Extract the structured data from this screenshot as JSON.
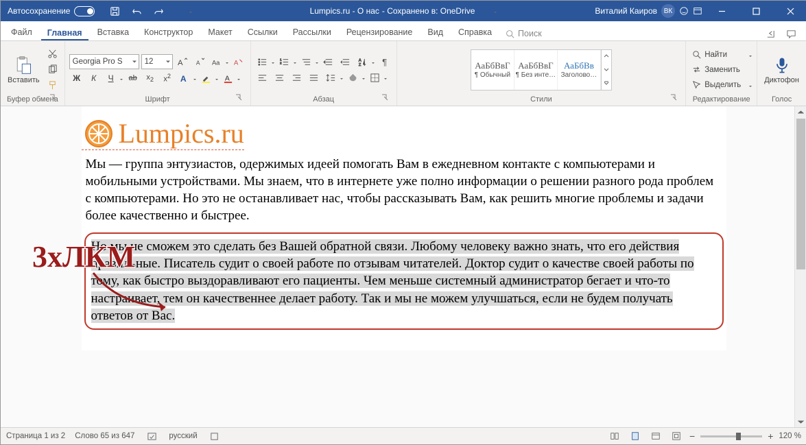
{
  "titlebar": {
    "autosave": "Автосохранение",
    "doc_title": "Lumpics.ru - О нас",
    "saved": "- Сохранено в: OneDrive",
    "user": "Виталий Каиров",
    "user_initials": "ВК"
  },
  "tabs": {
    "file": "Файл",
    "home": "Главная",
    "insert": "Вставка",
    "design": "Конструктор",
    "layout": "Макет",
    "references": "Ссылки",
    "mailings": "Рассылки",
    "review": "Рецензирование",
    "view": "Вид",
    "help": "Справка",
    "search": "Поиск"
  },
  "ribbon": {
    "paste": "Вставить",
    "clipboard": "Буфер обмена",
    "font_name": "Georgia Pro S",
    "font_size": "12",
    "font": "Шрифт",
    "paragraph": "Абзац",
    "style1": "¶ Обычный",
    "style2": "¶ Без инте…",
    "style3": "Заголово…",
    "style_preview": "АаБбВвГ",
    "style_preview3": "АаБбВв",
    "styles": "Стили",
    "find": "Найти",
    "replace": "Заменить",
    "select": "Выделить",
    "editing": "Редактирование",
    "dictate": "Диктофон",
    "voice": "Голос"
  },
  "document": {
    "logo": "Lumpics.ru",
    "p1": "Мы — группа энтузиастов, одержимых идеей помогать Вам в ежедневном контакте с компьютерами и мобильными устройствами. Мы знаем, что в интернете уже полно информации о решении разного рода проблем с компьютерами. Но это не останавливает нас, чтобы рассказывать Вам, как решить многие проблемы и задачи более качественно и быстрее.",
    "p2": "Но мы не сможем это сделать без Вашей обратной связи. Любому человеку важно знать, что его действия правильные. Писатель судит о своей работе по отзывам читателей. Доктор судит о качестве своей работы по тому, как быстро выздоравливают его пациенты. Чем меньше системный администратор бегает и что-то настраивает, тем он качественнее делает работу. Так и мы не можем улучшаться, если не будем получать ответов от Вас."
  },
  "annotation": "3хЛКМ",
  "status": {
    "page": "Страница 1 из 2",
    "words": "Слово 65 из 647",
    "lang": "русский",
    "zoom": "120 %"
  }
}
